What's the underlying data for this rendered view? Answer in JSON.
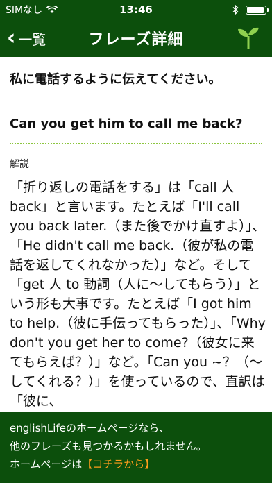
{
  "status_bar": {
    "carrier": "SIMなし",
    "time": "13:46",
    "battery_level": 0.85
  },
  "nav": {
    "back_label": "一覧",
    "title": "フレーズ詳細"
  },
  "phrase": {
    "japanese": "私に電話するように伝えてください。",
    "english": "Can you get him to call me back?"
  },
  "explanation": {
    "label": "解説",
    "text": "「折り返しの電話をする」は「call 人 back」と言います。たとえば「I'll call you back later.（また後でかけ直すよ）」、「He didn't call me back.（彼が私の電話を返してくれなかった）」など。そして「get 人 to 動詞（人に〜してもらう）」という形も大事です。たとえば「I got him to help.（彼に手伝ってもらった）」、「Why don't you get her to come?（彼女に来てもらえば？）」など。「Can you ~？（〜してくれる？）」を使っているので、直訳は「彼に、"
  },
  "footer": {
    "line1": "englishLifeのホームページなら、",
    "line2": "他のフレーズも見つかるかもしれません。",
    "line3_prefix": "ホームページは",
    "link_label": "【コチラから】"
  },
  "colors": {
    "bar_green": "#0c4f0c",
    "divider_green": "#8cc63f",
    "link_orange": "#ff9d1c"
  }
}
